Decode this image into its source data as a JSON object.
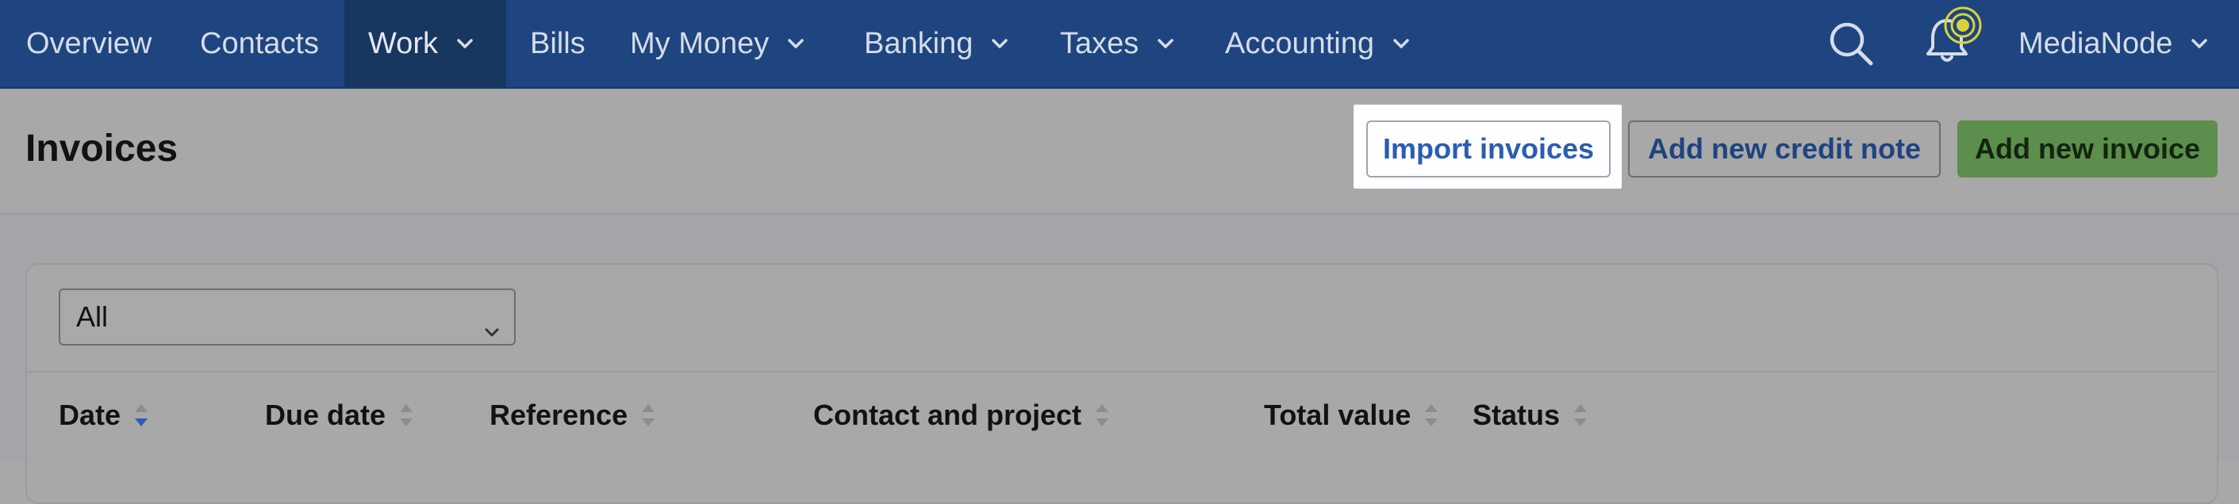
{
  "nav": {
    "items": [
      {
        "label": "Overview"
      },
      {
        "label": "Contacts"
      },
      {
        "label": "Work"
      },
      {
        "label": "Bills"
      },
      {
        "label": "My Money"
      },
      {
        "label": "Banking"
      },
      {
        "label": "Taxes"
      },
      {
        "label": "Accounting"
      }
    ],
    "active": "Work",
    "icons": [
      "search-icon",
      "bell-icon"
    ],
    "account": "MediaNode",
    "colors": {
      "background": "#1e4580",
      "active": "#17375f",
      "notification": "#d9d23a"
    }
  },
  "header": {
    "title": "Invoices",
    "buttons": {
      "import": "Import invoices",
      "credit_note": "Add new credit note",
      "invoice": "Add new invoice"
    }
  },
  "filter": {
    "selected": "All"
  },
  "table": {
    "columns": [
      {
        "label": "Date",
        "sort": "descending"
      },
      {
        "label": "Due date",
        "sort": "none"
      },
      {
        "label": "Reference",
        "sort": "none"
      },
      {
        "label": "Contact and project",
        "sort": "none"
      },
      {
        "label": "Total value",
        "sort": "none"
      },
      {
        "label": "Status",
        "sort": "none"
      }
    ]
  }
}
